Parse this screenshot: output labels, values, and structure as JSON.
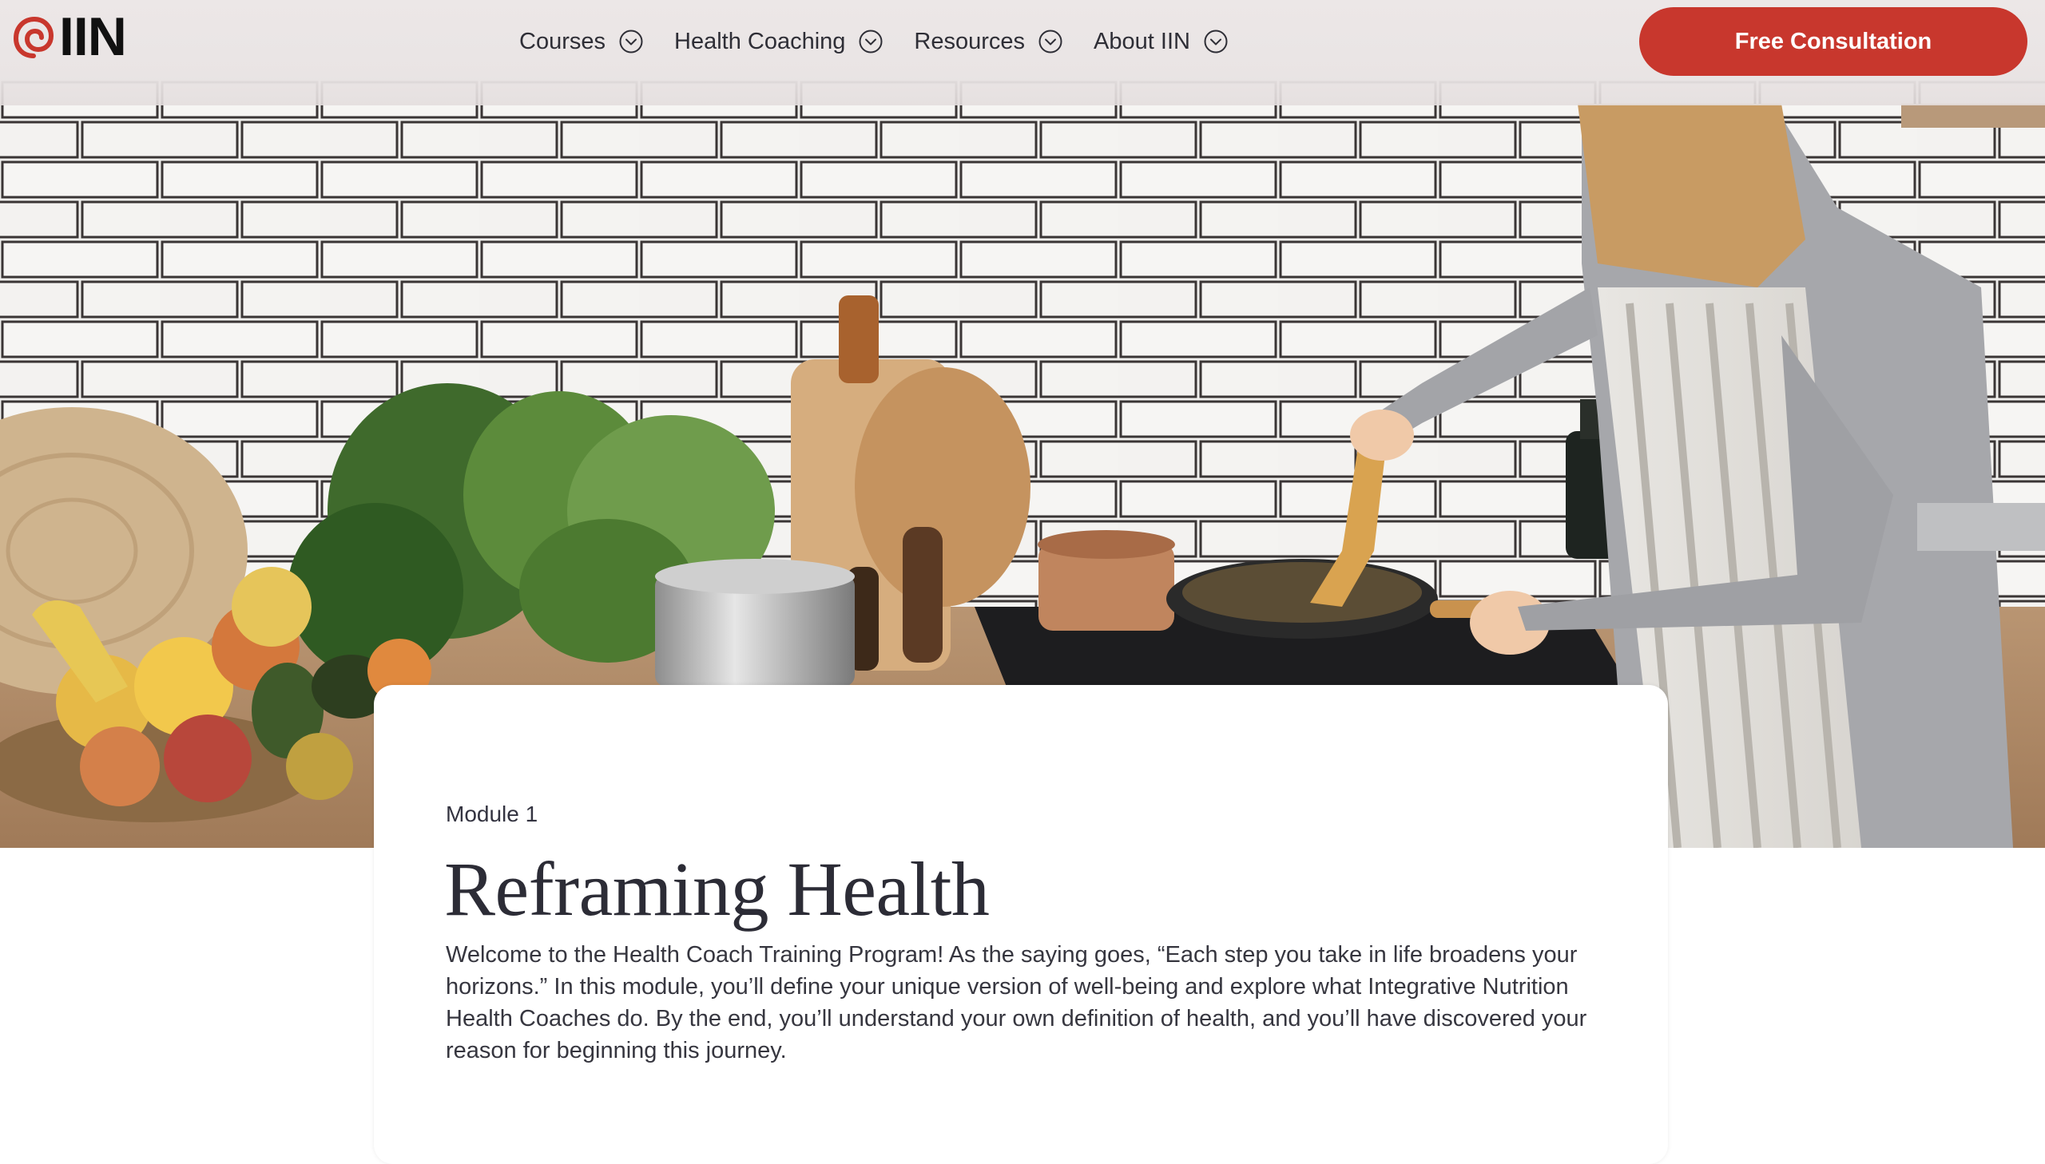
{
  "brand": {
    "logo_text": "IIN",
    "accent_color": "#c8372d"
  },
  "nav": {
    "items": [
      {
        "label": "Courses",
        "icon": "chevron-down-circle-icon"
      },
      {
        "label": "Health Coaching",
        "icon": "chevron-down-circle-icon"
      },
      {
        "label": "Resources",
        "icon": "chevron-down-circle-icon"
      },
      {
        "label": "About IIN",
        "icon": "chevron-down-circle-icon"
      }
    ],
    "cta_label": "Free Consultation"
  },
  "hero": {
    "image_alt": "Woman in striped apron cooking at a kitchen counter with vegetables and fruit"
  },
  "module": {
    "eyebrow": "Module 1",
    "title": "Reframing Health",
    "description": "Welcome to the Health Coach Training Program! As the saying goes, “Each step you take in life broadens your horizons.” In this module, you’ll define your unique version of well-being and explore what Integrative Nutrition Health Coaches do. By the end, you’ll understand your own definition of health, and you’ll have discovered your reason for beginning this journey."
  }
}
